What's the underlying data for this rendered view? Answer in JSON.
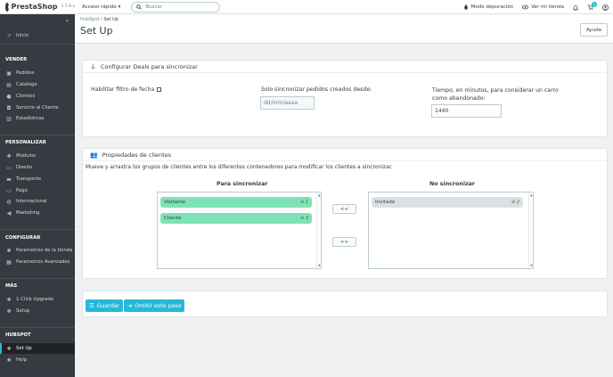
{
  "header": {
    "logo_text": "PrestaShop",
    "version": "1.7.8.x",
    "quick_access": "Acceso rápido",
    "search_placeholder": "Buscar",
    "debug_mode": "Modo depuración",
    "view_store": "Ver mi tienda",
    "notif_count": "1"
  },
  "sidebar": {
    "home": "Inicio",
    "sections": [
      {
        "title": "VENDER",
        "items": [
          "Pedidos",
          "Catalogo",
          "Clientes",
          "Servicio al Cliente",
          "Estadísticas"
        ]
      },
      {
        "title": "PERSONALIZAR",
        "items": [
          "Modulos",
          "Diseño",
          "Transporte",
          "Pago",
          "Internacional",
          "Marketing"
        ]
      },
      {
        "title": "CONFIGURAR",
        "items": [
          "Parametros de la tienda",
          "Parametros Avanzados"
        ]
      },
      {
        "title": "MÁS",
        "items": [
          "1-Click Upgrade",
          "Setup"
        ]
      },
      {
        "title": "HUBSPOT",
        "items": [
          "Set Up",
          "Help"
        ]
      }
    ]
  },
  "page": {
    "breadcrumb_parent": "HubSpot",
    "breadcrumb_sep": "/",
    "breadcrumb_current": "Set Up",
    "title": "Set Up",
    "help_button": "Ayuda"
  },
  "deals": {
    "title": "Configurar Deals para sincronizar",
    "date_filter_label": "Habilitar filtro de fecha",
    "sync_from_label": "Solo sincronizar pedidos creados desde:",
    "date_placeholder": "dd/mm/aaaa",
    "abandoned_label_1": "Tiempo, en minutos, para considerar un carro",
    "abandoned_label_2": "como abandonado:",
    "abandoned_value": "1440"
  },
  "customers": {
    "title": "Propiedades de clientes",
    "description": "Mueve y arrastra los grupos de clientes entre los diferentes contenedores para modificar los clientes a sincronizar.",
    "sync_title": "Para sincronizar",
    "nosync_title": "No sincronizar",
    "sync_groups": [
      {
        "name": "Visitante",
        "count": "1"
      },
      {
        "name": "Cliente",
        "count": "3"
      }
    ],
    "nosync_groups": [
      {
        "name": "Invitado",
        "count": "2"
      }
    ],
    "move_left": "<<",
    "move_right": ">>"
  },
  "actions": {
    "save": "Guardar",
    "skip": "Omitir este paso"
  },
  "colors": {
    "accent": "#25b9d7",
    "sidebar_bg": "#363a41",
    "tag_green": "#7ee3b4"
  }
}
